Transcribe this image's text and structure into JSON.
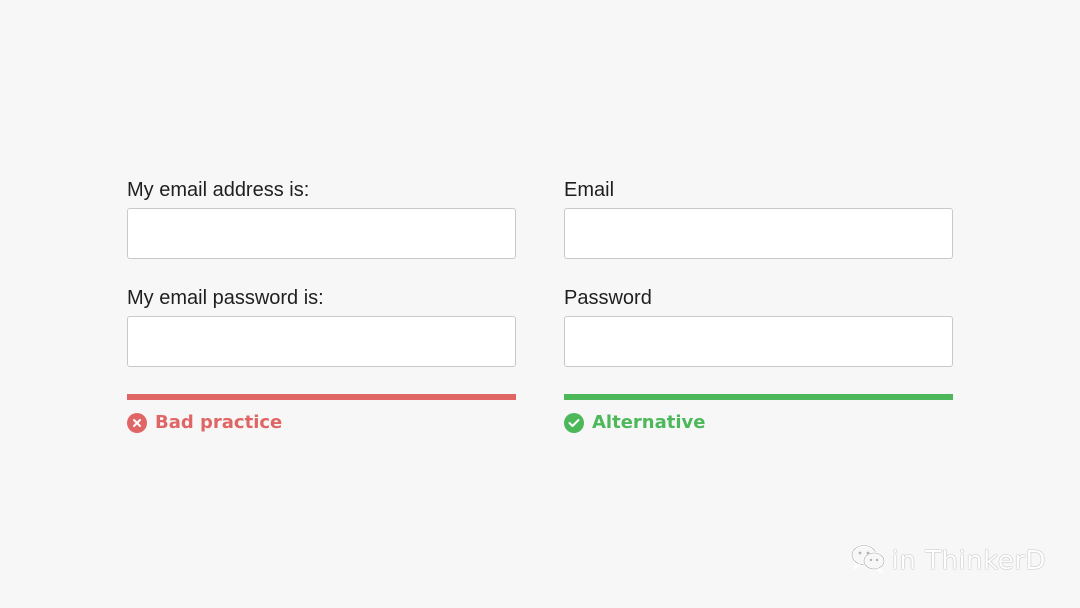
{
  "bad_example": {
    "email_label": "My email address is:",
    "password_label": "My email password is:",
    "email_value": "",
    "password_value": "",
    "status_text": "Bad practice",
    "status_icon": "x-circle-icon",
    "color": "#e06666"
  },
  "good_example": {
    "email_label": "Email",
    "password_label": "Password",
    "email_value": "",
    "password_value": "",
    "status_text": "Alternative",
    "status_icon": "check-circle-icon",
    "color": "#4cb85a"
  },
  "watermark": {
    "text": "in ThinkerD",
    "icon": "wechat-icon"
  }
}
